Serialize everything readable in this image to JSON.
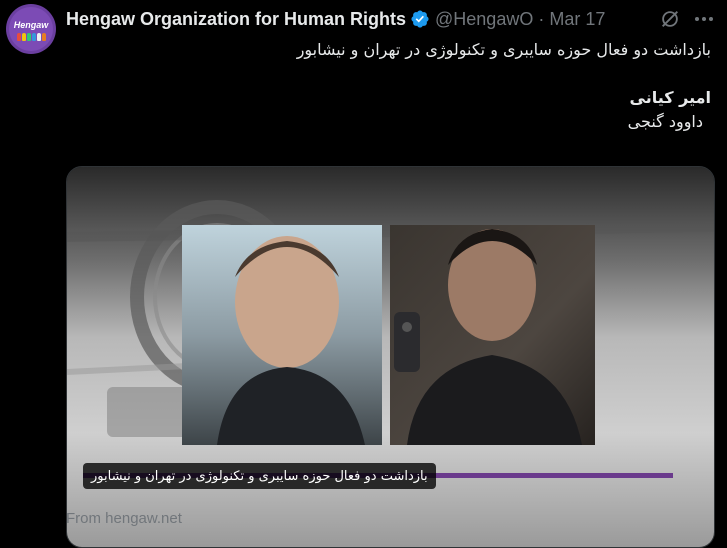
{
  "tweet": {
    "author_name": "Hengaw Organization for Human Rights",
    "handle": "@HengawO",
    "separator": "·",
    "date": "Mar 17",
    "avatar_text": "Hengaw",
    "text_lines": [
      "بازداشت دو فعال حوزه سایبری و تکنولوژی در تهران و نیشابور",
      "",
      "امیر کیانی",
      "داوود گنجی"
    ]
  },
  "card": {
    "caption": "بازداشت دو فعال حوزه سایبری و تکنولوژی در تهران و نیشابور",
    "source": "From hengaw.net"
  },
  "icons": {
    "verified": "verified-badge-icon",
    "grok": "grok-icon",
    "more": "more-options-icon"
  },
  "colors": {
    "background": "#000000",
    "verified_blue": "#1d9bf0",
    "muted_text": "#71767b",
    "avatar_purple": "#6b3fa0",
    "caption_bar_purple": "#6a3a8c"
  }
}
